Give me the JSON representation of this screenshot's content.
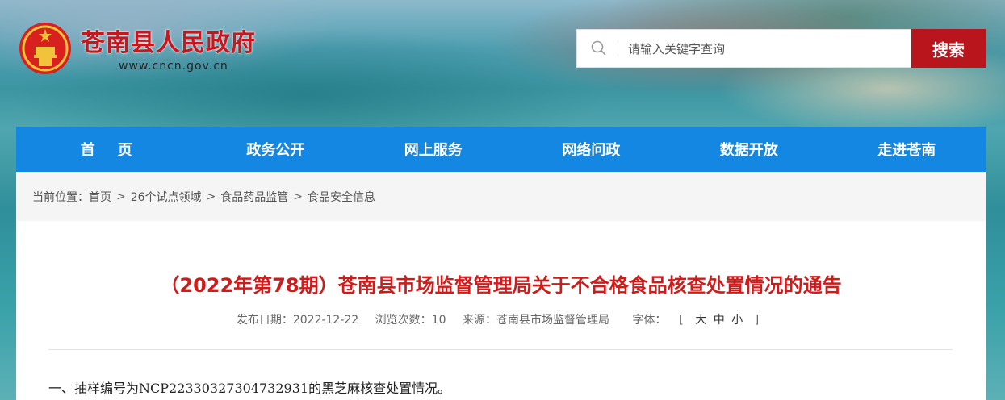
{
  "header": {
    "site_name": "苍南县人民政府",
    "site_url": "www.cncn.gov.cn",
    "search": {
      "placeholder": "请输入关键字查询",
      "button_label": "搜索"
    }
  },
  "nav": {
    "items": [
      {
        "label": "首页"
      },
      {
        "label": "政务公开"
      },
      {
        "label": "网上服务"
      },
      {
        "label": "网络问政"
      },
      {
        "label": "数据开放"
      },
      {
        "label": "走进苍南"
      }
    ]
  },
  "breadcrumb": {
    "prefix": "当前位置：",
    "items": [
      "首页",
      "26个试点领域",
      "食品药品监管",
      "食品安全信息"
    ],
    "separator": ">"
  },
  "article": {
    "title": "（2022年第78期）苍南县市场监督管理局关于不合格食品核查处置情况的通告",
    "publish_date_label": "发布日期：2022-12-22",
    "views_label": "浏览次数：10",
    "source_label": "来源：苍南县市场监督管理局",
    "font_label": "字体：",
    "font_bracket_open": "[",
    "font_sizes": [
      "大",
      "中",
      "小"
    ],
    "font_bracket_close": "]",
    "first_paragraph": "一、抽样编号为NCP22330327304732931的黑芝麻核查处置情况。"
  },
  "colors": {
    "brand_red": "#c9161c",
    "nav_blue": "#1387e1",
    "search_button": "#b8161c",
    "title_red": "#d11b1b"
  }
}
